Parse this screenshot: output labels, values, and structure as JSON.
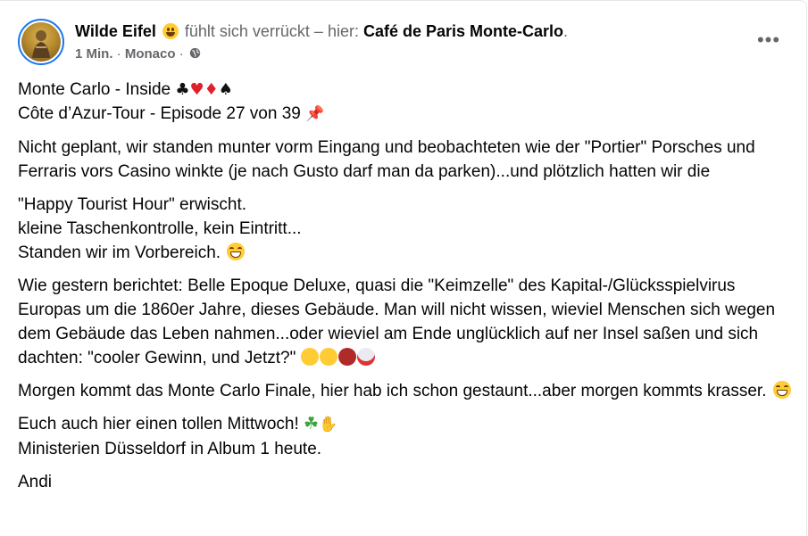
{
  "post": {
    "author": "Wilde Eifel",
    "feeling_text": "fühlt sich verrückt – hier:",
    "place": "Café de Paris Monte-Carlo",
    "place_suffix": ".",
    "time": "1 Min.",
    "separator": " · ",
    "location": "Monaco",
    "separator2": " · ",
    "more_label": "•••",
    "icons": {
      "more": "more-options-icon",
      "privacy": "globe-icon",
      "feeling": "crazy-face-emoji"
    }
  },
  "content": {
    "line1": "Monte Carlo - Inside",
    "line1_symbols": [
      "♣",
      "♥",
      "♦",
      "♠"
    ],
    "line2": "Côte d’Azur-Tour - Episode 27 von 39",
    "line2_emoji": "📌",
    "p1": "Nicht geplant, wir standen munter vorm Eingang und beobachteten wie der \"Portier\" Porsches und Ferraris vors Casino winkte (je nach Gusto darf man da parken)...und plötzlich hatten wir die",
    "p2_l1": "\"Happy Tourist Hour\" erwischt.",
    "p2_l2": "kleine Taschenkontrolle, kein Eintritt...",
    "p2_l3": "Standen wir im Vorbereich.",
    "p3": "Wie gestern berichtet: Belle Epoque Deluxe, quasi die \"Keimzelle\" des Kapital-/Glücksspielvirus Europas um die 1860er Jahre, dieses Gebäude. Man will nicht wissen, wieviel Menschen sich wegen dem Gebäude das Leben nahmen...oder wieviel am Ende unglücklich auf ner Insel saßen und sich dachten: \"cooler Gewinn, und Jetzt?\"",
    "p4": "Morgen kommt das Monte Carlo Finale, hier hab ich schon gestaunt...aber morgen kommts krasser.",
    "p5_l1": "Euch auch hier einen tollen Mittwoch!",
    "p5_l2": "Ministerien Düsseldorf in Album 1 heute.",
    "p6": "Andi"
  },
  "colors": {
    "accent": "#1877f2",
    "text": "#050505",
    "secondary": "#65676b"
  }
}
